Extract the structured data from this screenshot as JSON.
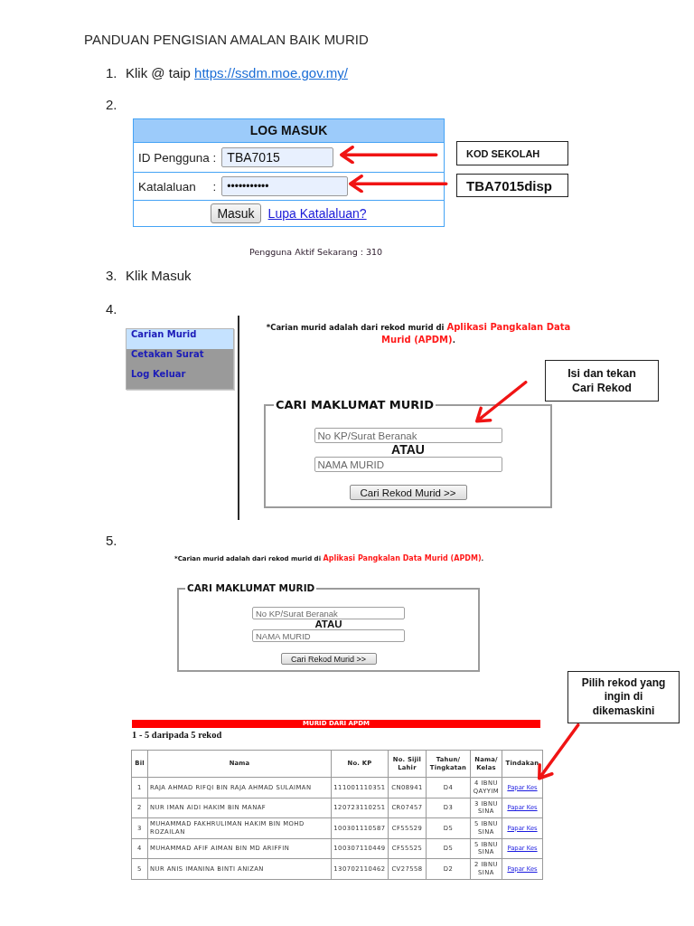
{
  "document": {
    "title": "PANDUAN PENGISIAN AMALAN BAIK MURID"
  },
  "steps": [
    {
      "kind": "text",
      "number": "1.",
      "text": "Klik @ taip",
      "link": "https://ssdm.moe.gov.my/"
    },
    {
      "kind": "login",
      "number": "2.",
      "login_panel": {
        "title": "LOG MASUK",
        "fields": [
          {
            "kind": "text",
            "label": "ID Pengguna :",
            "value": "TBA7015"
          },
          {
            "kind": "password",
            "label": "Katalaluan     :",
            "value": "•••••••••••"
          }
        ],
        "button": "Masuk",
        "link": "Lupa Katalaluan?"
      },
      "status": "Pengguna Aktif Sekarang : 310",
      "callouts": [
        "KOD SEKOLAH",
        "TBA7015disp"
      ]
    },
    {
      "kind": "text",
      "number": "3.",
      "text": "Klik Masuk"
    },
    {
      "kind": "search",
      "number": "4.",
      "menu": [
        {
          "label": "Carian Murid",
          "selected": true
        },
        {
          "label": "Cetakan Surat",
          "selected": false
        },
        {
          "label": "Log Keluar",
          "selected": false
        }
      ],
      "notice": {
        "text": "*Carian murid adalah dari rekod murid di",
        "source": "Aplikasi Pangkalan Data Murid (APDM)",
        "end": "."
      },
      "form": {
        "legend": "CARI MAKLUMAT MURID",
        "fields": [
          {
            "placeholder": "No KP/Surat Beranak"
          },
          {
            "placeholder": "NAMA MURID"
          }
        ],
        "separator": "ATAU",
        "button": "Cari Rekod Murid >>"
      },
      "callouts": [
        "Isi dan tekan Cari Rekod"
      ]
    },
    {
      "kind": "results",
      "number": "5.",
      "notice": {
        "text": "*Carian murid adalah dari rekod murid di",
        "source": "Aplikasi Pangkalan Data Murid (APDM)",
        "end": "."
      },
      "form": {
        "legend": "CARI MAKLUMAT MURID",
        "fields": [
          {
            "placeholder": "No KP/Surat Beranak"
          },
          {
            "placeholder": "NAMA MURID"
          }
        ],
        "separator": "ATAU",
        "button": "Cari Rekod Murid >>"
      },
      "callouts": [
        "Pilih rekod yang ingin di dikemaskini"
      ],
      "results": {
        "banner": "MURID DARI APDM",
        "count": "1 - 5 daripada 5 rekod",
        "columns": [
          "Bil",
          "Nama",
          "No. KP",
          "No. Sijil Lahir",
          "Tahun/ Tingkatan",
          "Nama/ Kelas",
          "Tindakan"
        ],
        "rows": [
          {
            "cells": [
              "1",
              "RAJA AHMAD RIFQI BIN RAJA AHMAD SULAIMAN",
              "111001110351",
              "CN08941",
              "D4",
              "4 IBNU QAYYIM"
            ],
            "action": "Papar Kes"
          },
          {
            "cells": [
              "2",
              "NUR IMAN AIDI HAKIM BIN MANAF",
              "120723110251",
              "CR07457",
              "D3",
              "3 IBNU SINA"
            ],
            "action": "Papar Kes"
          },
          {
            "cells": [
              "3",
              "MUHAMMAD FAKHRULIMAN HAKIM BIN MOHD ROZAILAN",
              "100301110587",
              "CF55529",
              "D5",
              "5 IBNU SINA"
            ],
            "action": "Papar Kes"
          },
          {
            "cells": [
              "4",
              "MUHAMMAD AFIF AIMAN BIN MD ARIFFIN",
              "100307110449",
              "CF55525",
              "D5",
              "5 IBNU SINA"
            ],
            "action": "Papar Kes"
          },
          {
            "cells": [
              "5",
              "NUR ANIS IMANINA BINTI ANIZAN",
              "130702110462",
              "CV27558",
              "D2",
              "2 IBNU SINA"
            ],
            "action": "Papar Kes"
          }
        ]
      }
    }
  ]
}
